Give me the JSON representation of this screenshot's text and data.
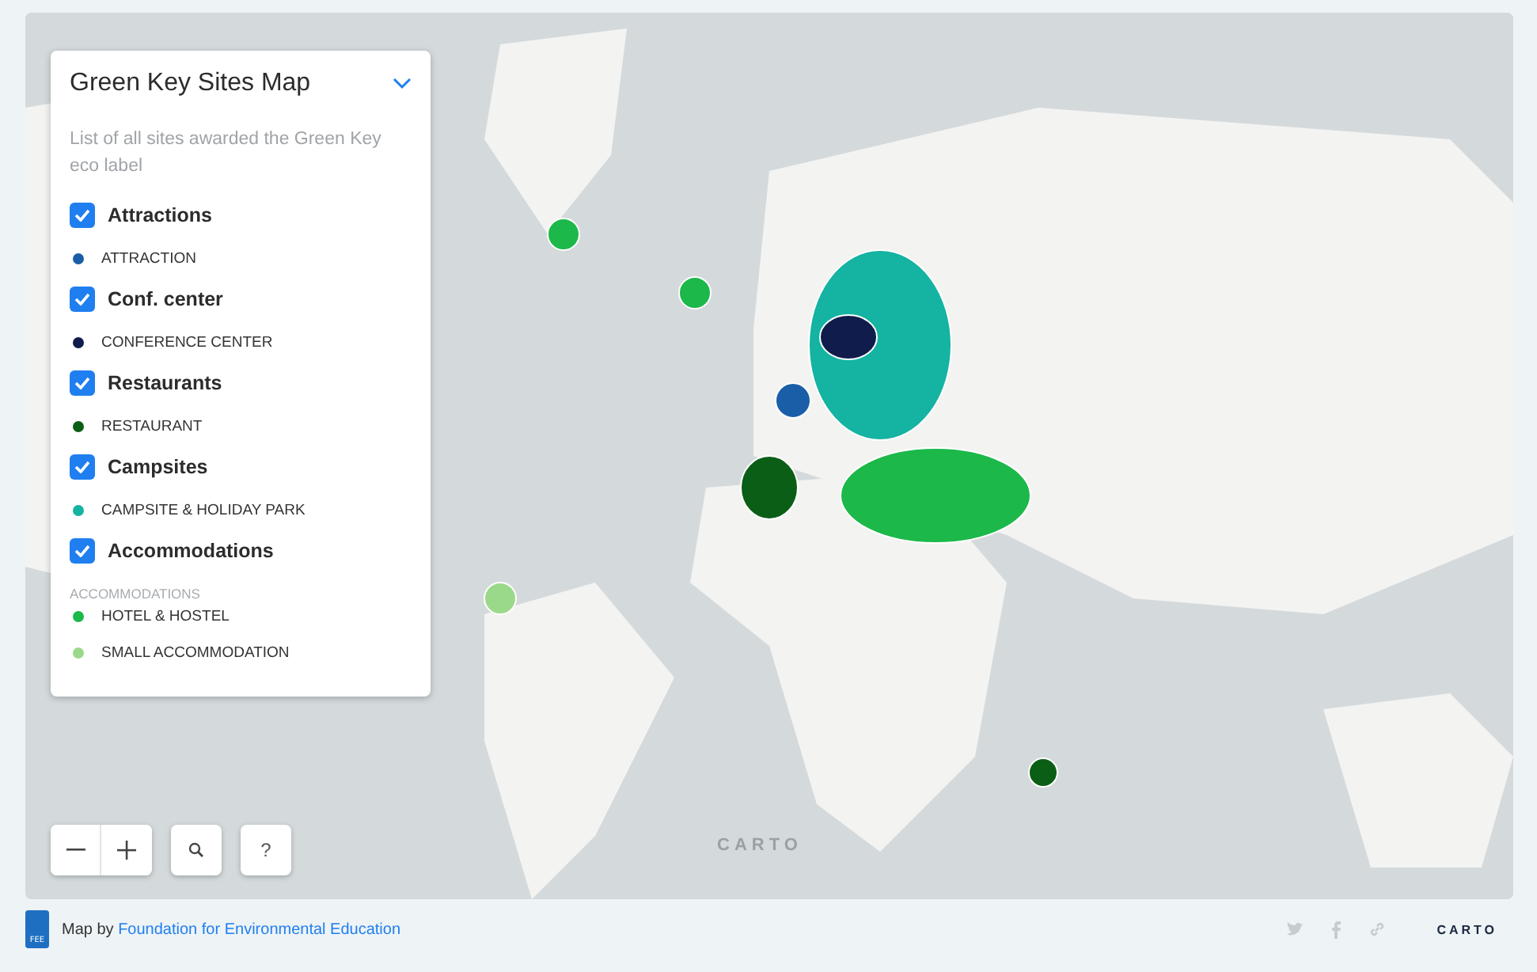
{
  "legend": {
    "title": "Green Key Sites Map",
    "expanded": true,
    "description": "List of all sites awarded the Green Key eco label",
    "groups": [
      {
        "label": "Attractions",
        "checked": true,
        "items": [
          {
            "label": "ATTRACTION",
            "color": "#1a5ea8"
          }
        ]
      },
      {
        "label": "Conf. center",
        "checked": true,
        "items": [
          {
            "label": "CONFERENCE CENTER",
            "color": "#101c4c"
          }
        ]
      },
      {
        "label": "Restaurants",
        "checked": true,
        "items": [
          {
            "label": "RESTAURANT",
            "color": "#0b5e16"
          }
        ]
      },
      {
        "label": "Campsites",
        "checked": true,
        "items": [
          {
            "label": "CAMPSITE & HOLIDAY PARK",
            "color": "#14b3a2"
          }
        ]
      },
      {
        "label": "Accommodations",
        "checked": true,
        "heading": "ACCOMMODATIONS",
        "items": [
          {
            "label": "HOTEL & HOSTEL",
            "color": "#1cb84a"
          },
          {
            "label": "SMALL ACCOMMODATION",
            "color": "#9bd98a"
          }
        ]
      }
    ]
  },
  "controls": {
    "help": "?"
  },
  "map_logo": "CARTO",
  "footer": {
    "badge": "FEE",
    "prefix": "Map by",
    "link": "Foundation for Environmental Education",
    "logo": "CARTO"
  }
}
